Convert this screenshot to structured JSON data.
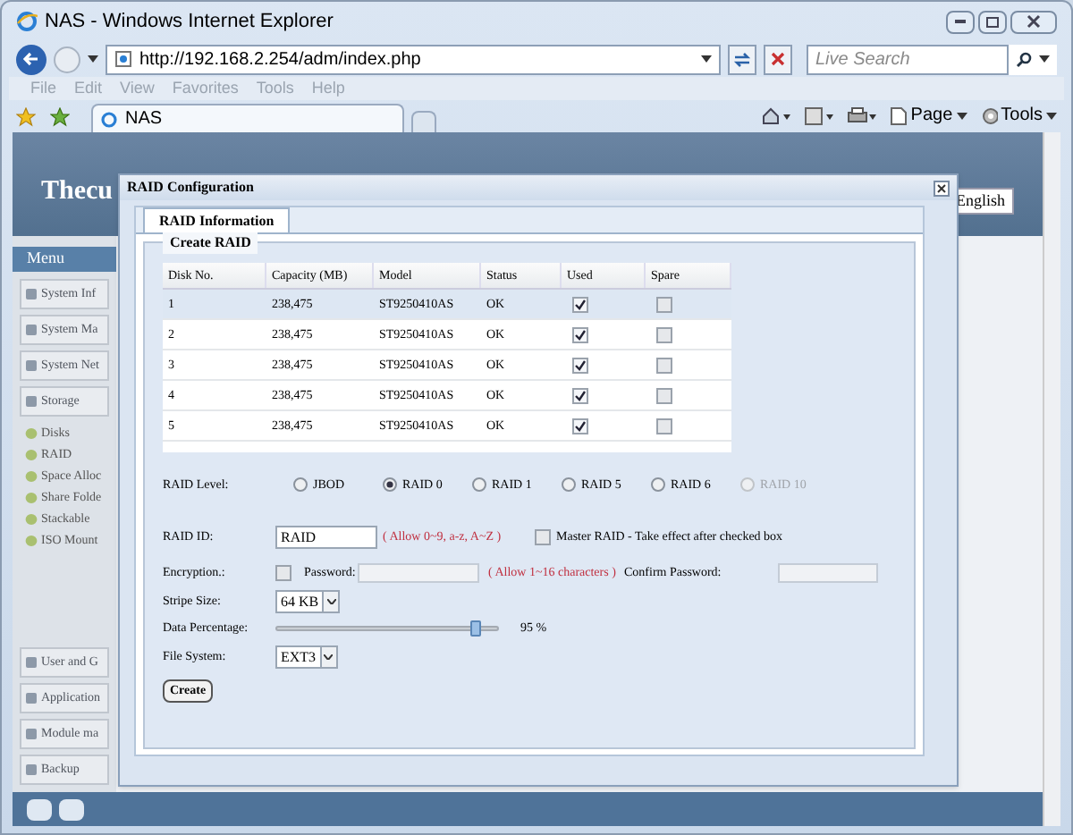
{
  "window": {
    "title": "NAS - Windows Internet Explorer"
  },
  "address_bar": {
    "url": "http://192.168.2.254/adm/index.php"
  },
  "search": {
    "placeholder": "Live Search"
  },
  "menu_bar": [
    "File",
    "Edit",
    "View",
    "Favorites",
    "Tools",
    "Help"
  ],
  "tabs": [
    {
      "label": "NAS",
      "selected": true
    }
  ],
  "command_bar": [
    "Page",
    "Tools"
  ],
  "nas_page": {
    "logo": "Thecu",
    "language": "English",
    "menu_title": "Menu",
    "menu": [
      {
        "label": "System Inf"
      },
      {
        "label": "System Ma"
      },
      {
        "label": "System Net"
      },
      {
        "label": "Storage",
        "children": [
          {
            "label": "Disks"
          },
          {
            "label": "RAID"
          },
          {
            "label": "Space Alloc"
          },
          {
            "label": "Share Folde"
          },
          {
            "label": "Stackable"
          },
          {
            "label": "ISO Mount"
          }
        ]
      },
      {
        "label": "User and G"
      },
      {
        "label": "Application"
      },
      {
        "label": "Module ma"
      },
      {
        "label": "Backup"
      }
    ]
  },
  "dialog": {
    "title": "RAID Configuration",
    "tabs": [
      {
        "label": "RAID Information",
        "selected": true
      }
    ],
    "section": "Create RAID",
    "table": {
      "columns": [
        "Disk No.",
        "Capacity (MB)",
        "Model",
        "Status",
        "Used",
        "Spare"
      ],
      "rows": [
        {
          "disk": "1",
          "capacity": "238,475",
          "model": "ST9250410AS",
          "status": "OK",
          "used": true,
          "spare": false,
          "selected": true
        },
        {
          "disk": "2",
          "capacity": "238,475",
          "model": "ST9250410AS",
          "status": "OK",
          "used": true,
          "spare": false,
          "selected": false
        },
        {
          "disk": "3",
          "capacity": "238,475",
          "model": "ST9250410AS",
          "status": "OK",
          "used": true,
          "spare": false,
          "selected": false
        },
        {
          "disk": "4",
          "capacity": "238,475",
          "model": "ST9250410AS",
          "status": "OK",
          "used": true,
          "spare": false,
          "selected": false
        },
        {
          "disk": "5",
          "capacity": "238,475",
          "model": "ST9250410AS",
          "status": "OK",
          "used": true,
          "spare": false,
          "selected": false
        }
      ]
    },
    "raid_level": {
      "label": "RAID Level:",
      "options": [
        {
          "label": "JBOD",
          "selected": false,
          "disabled": false
        },
        {
          "label": "RAID 0",
          "selected": true,
          "disabled": false
        },
        {
          "label": "RAID 1",
          "selected": false,
          "disabled": false
        },
        {
          "label": "RAID 5",
          "selected": false,
          "disabled": false
        },
        {
          "label": "RAID 6",
          "selected": false,
          "disabled": false
        },
        {
          "label": "RAID 10",
          "selected": false,
          "disabled": true
        }
      ]
    },
    "raid_id": {
      "label": "RAID ID:",
      "value": "RAID",
      "hint": "( Allow 0~9, a-z, A~Z )"
    },
    "master_raid": {
      "label": "Master RAID - Take effect after checked box",
      "checked": false
    },
    "encryption": {
      "label": "Encryption.:",
      "checked": false,
      "password_label": "Password:",
      "hint": "( Allow 1~16 characters )",
      "confirm_label": "Confirm Password:"
    },
    "stripe_size": {
      "label": "Stripe Size:",
      "value": "64 KB"
    },
    "data_percentage": {
      "label": "Data Percentage:",
      "level": 0.95,
      "reading": "95 %"
    },
    "file_system": {
      "label": "File System:",
      "value": "EXT3"
    },
    "button": "Create"
  }
}
